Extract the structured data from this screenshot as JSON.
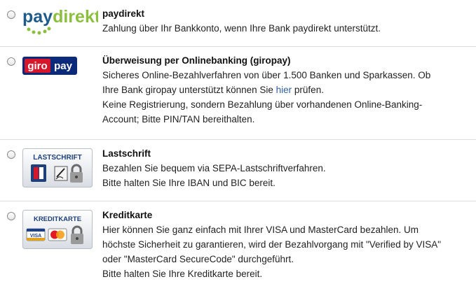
{
  "options": [
    {
      "id": "paydirekt",
      "logo_text": "paydirekt",
      "logo_text_parts": [
        "pay",
        "direkt"
      ],
      "title": "paydirekt",
      "lines": [
        "Zahlung über Ihr Bankkonto, wenn Ihre Bank paydirekt unterstützt."
      ]
    },
    {
      "id": "giropay",
      "logo_text_parts": [
        "giro",
        "pay"
      ],
      "title": "Überweisung per Onlinebanking (giropay)",
      "lines": [
        "Sicheres Online-Bezahlverfahren von über 1.500 Banken und Sparkassen. Ob",
        "Ihre Bank giropay unterstützt können Sie ",
        "Keine Registrierung, sondern Bezahlung über vorhandenen Online-Banking-",
        "Account; Bitte PIN/TAN bereithalten."
      ],
      "link_text": "hier",
      "link_suffix": " prüfen."
    },
    {
      "id": "lastschrift",
      "logo_text": "LASTSCHRIFT",
      "title": "Lastschrift",
      "lines": [
        "Bezahlen Sie bequem via SEPA-Lastschriftverfahren.",
        "Bitte halten Sie Ihre IBAN und BIC bereit."
      ]
    },
    {
      "id": "kreditkarte",
      "logo_text": "KREDITKARTE",
      "logo_card_text": "VISA",
      "title": "Kreditkarte",
      "lines": [
        "Hier können Sie ganz einfach mit Ihrer VISA und MasterCard bezahlen. Um",
        "höchste Sicherheit zu garantieren, wird der Bezahlvorgang mit \"Verified by VISA\"",
        "oder \"MasterCard SecureCode\" durchgeführt.",
        "Bitte halten Sie Ihre Kreditkarte bereit."
      ]
    }
  ],
  "colors": {
    "paydirekt_blue": "#1f5b8a",
    "paydirekt_green": "#8cbf3f",
    "giropay_navy": "#0b2a7a",
    "giropay_red": "#d6162b",
    "link": "#2f5f9f",
    "separator": "#dcdcdc"
  }
}
